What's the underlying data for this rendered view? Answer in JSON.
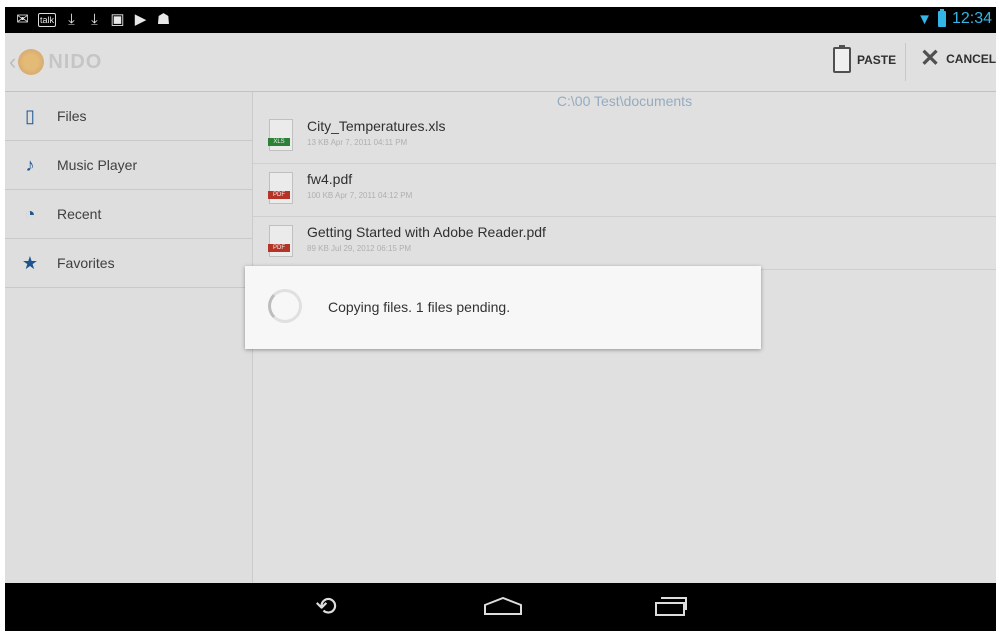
{
  "status_bar": {
    "left_icons": [
      "gmail-icon",
      "talk-icon",
      "download-icon",
      "download-icon",
      "sd-card-icon",
      "play-store-icon",
      "android-debug-icon"
    ],
    "talk_label": "talk",
    "time": "12:34",
    "accent_color": "#33b5e5"
  },
  "action_bar": {
    "logo_text": "NIDO",
    "paste_label": "PASTE",
    "cancel_label": "CANCEL"
  },
  "sidebar": {
    "items": [
      {
        "label": "Files",
        "icon": "files-icon"
      },
      {
        "label": "Music Player",
        "icon": "music-note-icon"
      },
      {
        "label": "Recent",
        "icon": "clock-icon"
      },
      {
        "label": "Favorites",
        "icon": "star-icon"
      }
    ]
  },
  "content": {
    "path": "C:\\00 Test\\documents",
    "files": [
      {
        "name": "City_Temperatures.xls",
        "meta": "13 KB  Apr 7, 2011 04:11 PM",
        "type": "XLS"
      },
      {
        "name": "fw4.pdf",
        "meta": "100 KB  Apr 7, 2011 04:12 PM",
        "type": "PDF"
      },
      {
        "name": "Getting Started with Adobe Reader.pdf",
        "meta": "89 KB  Jul 29, 2012 06:15 PM",
        "type": "PDF"
      }
    ]
  },
  "dialog": {
    "message": "Copying files. 1 files pending."
  },
  "nav_bar": {
    "buttons": [
      "back-icon",
      "home-icon",
      "recent-apps-icon"
    ]
  }
}
